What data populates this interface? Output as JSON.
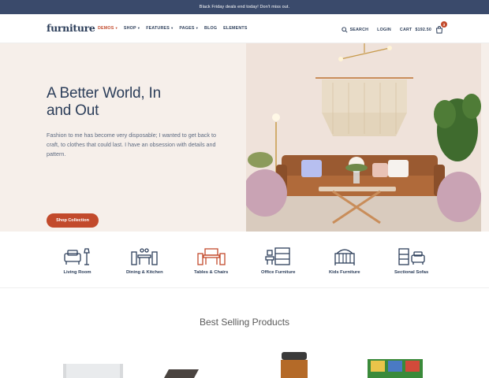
{
  "topbar": {
    "text": "Black Friday deals end today! Don't miss out."
  },
  "nav": {
    "logo": "furniture",
    "menu": [
      {
        "label": "DEMOS",
        "dropdown": true,
        "active": true
      },
      {
        "label": "SHOP",
        "dropdown": true
      },
      {
        "label": "FEATURES",
        "dropdown": true
      },
      {
        "label": "PAGES",
        "dropdown": true
      },
      {
        "label": "BLOG",
        "dropdown": false
      },
      {
        "label": "ELEMENTS",
        "dropdown": false
      }
    ],
    "search_label": "SEARCH",
    "login_label": "LOGIN",
    "cart_label": "CART",
    "cart_total": "$192.50",
    "cart_count": "3"
  },
  "hero": {
    "title_line1": "A Better World, In",
    "title_line2": "and Out",
    "description": "Fashion to me has become very disposable; I wanted to get back to craft, to clothes that could last. I have an obsession with details and pattern.",
    "button_label": "Shop Collection"
  },
  "categories": [
    {
      "label": "Living Room",
      "icon": "sofa-lamp-icon"
    },
    {
      "label": "Dining & Kitchen",
      "icon": "dining-table-icon"
    },
    {
      "label": "Tables & Chairs",
      "icon": "table-chairs-icon",
      "active": true
    },
    {
      "label": "Office Furniture",
      "icon": "office-desk-icon"
    },
    {
      "label": "Kids Furniture",
      "icon": "crib-icon"
    },
    {
      "label": "Sectional Sofas",
      "icon": "armchair-drawers-icon"
    }
  ],
  "best_selling": {
    "title": "Best Selling Products"
  },
  "colors": {
    "accent": "#c24a2c",
    "navy": "#2c3e5a",
    "topbar": "#3a4a6b",
    "hero_bg": "#f6efea"
  }
}
